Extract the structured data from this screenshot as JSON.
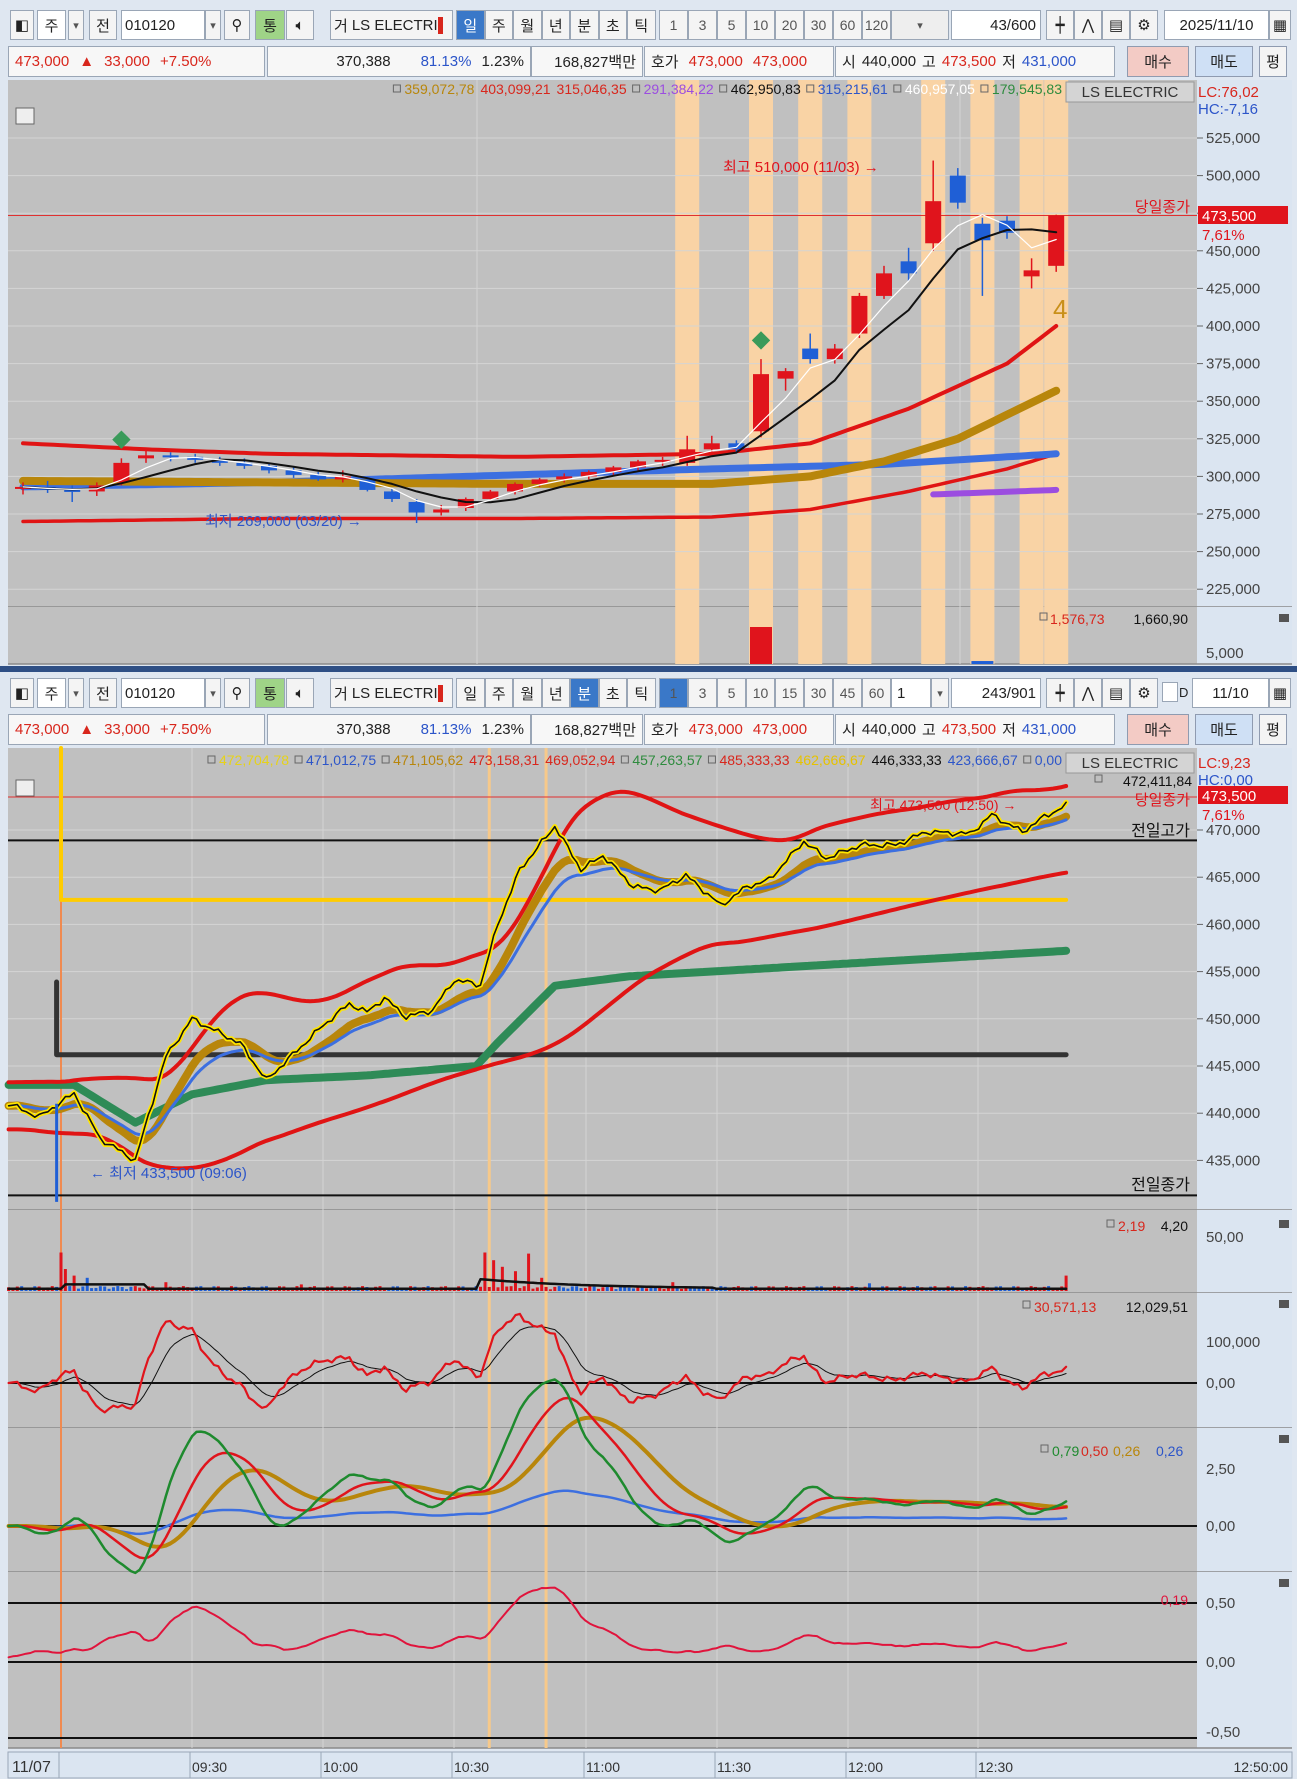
{
  "top_window": {
    "toolbar": {
      "market": "주",
      "prev": "전",
      "code": "010120",
      "tong": "통",
      "geo": "거",
      "name": "LS ELECTRI",
      "periods": [
        "일",
        "주",
        "월",
        "년",
        "분",
        "초",
        "틱"
      ],
      "active_period": "일",
      "intervals": [
        "1",
        "3",
        "5",
        "10",
        "20",
        "30",
        "60",
        "120"
      ],
      "count": "43",
      "total": "/600",
      "date": "2025/11/10"
    },
    "legend": [
      {
        "v": "359,072,78",
        "c": "#b8860b",
        "box": true
      },
      {
        "v": "403,099,21",
        "c": "#d8261c"
      },
      {
        "v": "315,046,35",
        "c": "#d8261c"
      },
      {
        "v": "291,384,22",
        "c": "#9b4de0",
        "box": true
      },
      {
        "v": "462,950,83",
        "c": "#111111",
        "box": true
      },
      {
        "v": "315,215,61",
        "c": "#2c55c9",
        "box": true
      },
      {
        "v": "460,957,05",
        "c": "#ffffff",
        "box": true
      },
      {
        "v": "179,545,83",
        "c": "#2e8b3e",
        "box": true
      }
    ],
    "title": "LS ELECTRIC",
    "lc": "LC:76,02",
    "hc": "HC:-7,16",
    "high_label": "최고 510,000 (11/03) →",
    "low_label": "최저 269,000 (03/20) →",
    "close_label": "당일종가",
    "signal": "4",
    "price_tag": "473,500",
    "pct_tag": "7,61%",
    "vol_legend": [
      "1,576,73",
      "1,660,90"
    ],
    "axis": [
      "525,000",
      "500,000",
      "475,000",
      "450,000",
      "425,000",
      "400,000",
      "375,000",
      "350,000",
      "325,000",
      "300,000",
      "275,000",
      "250,000",
      "225,000"
    ],
    "vol_axis": "5,000"
  },
  "bottom_window": {
    "toolbar": {
      "market": "주",
      "prev": "전",
      "code": "010120",
      "tong": "통",
      "geo": "거",
      "name": "LS ELECTRI",
      "periods": [
        "일",
        "주",
        "월",
        "년",
        "분",
        "초",
        "틱"
      ],
      "active_period": "분",
      "intervals": [
        "1",
        "3",
        "5",
        "10",
        "15",
        "30",
        "45",
        "60"
      ],
      "active_interval": "1",
      "unit": "1",
      "count": "243",
      "total": "/901",
      "check": "D",
      "date": "11/10"
    },
    "legend": [
      {
        "v": "472,704,78",
        "c": "#e6d21a",
        "box": true
      },
      {
        "v": "471,012,75",
        "c": "#2c55c9",
        "box": true
      },
      {
        "v": "471,105,62",
        "c": "#b8860b",
        "box": true
      },
      {
        "v": "473,158,31",
        "c": "#d8261c"
      },
      {
        "v": "469,052,94",
        "c": "#d8261c"
      },
      {
        "v": "457,263,57",
        "c": "#2e8b3e",
        "box": true
      },
      {
        "v": "485,333,33",
        "c": "#d8261c",
        "box": true
      },
      {
        "v": "462,666,67",
        "c": "#e6c200"
      },
      {
        "v": "446,333,33",
        "c": "#111111"
      },
      {
        "v": "423,666,67",
        "c": "#2c55c9"
      },
      {
        "v": "0,00",
        "c": "#2c55c9",
        "box": true
      }
    ],
    "legend2": "472,411,84",
    "title": "LS ELECTRIC",
    "lc": "LC:9,23",
    "hc": "HC:0,00",
    "high_label": "최고 473,500 (12:50) →",
    "low_label": "← 최저 433,500 (09:06)",
    "prev_high": "전일고가",
    "prev_close": "전일종가",
    "close_label": "당일종가",
    "price_tag": "473,500",
    "pct_tag": "7,61%",
    "axis": [
      "470,000",
      "465,000",
      "460,000",
      "455,000",
      "450,000",
      "445,000",
      "440,000",
      "435,000"
    ],
    "vol_legend": [
      "2,19",
      "4,20"
    ],
    "vol_axis": "50,00",
    "p3_legend": [
      "30,571,13",
      "12,029,51"
    ],
    "p3_axis": [
      "100,000",
      "0,00"
    ],
    "p4_legend": [
      "0,79",
      "0,50",
      "0,26",
      "0,26"
    ],
    "p4_axis": [
      "2,50",
      "0,00"
    ],
    "p5_legend": "0,19",
    "p5_axis": [
      "0,50",
      "0,00",
      "-0,50"
    ],
    "time_labels": [
      "11/07",
      "09:30",
      "10:00",
      "10:30",
      "11:00",
      "11:30",
      "12:00",
      "12:30"
    ],
    "time_end": "12:50:00"
  },
  "info": {
    "price": "473,000",
    "arrow": "▲",
    "change": "33,000",
    "pct": "+7.50%",
    "volume": "370,388",
    "ratio": "81.13%",
    "turnover": "1.23%",
    "amount": "168,827백만",
    "hoga_label": "호가",
    "ask": "473,000",
    "bid": "473,000",
    "open_label": "시",
    "open": "440,000",
    "high_label": "고",
    "high": "473,500",
    "low_label": "저",
    "low": "431,000",
    "buy": "매수",
    "sell": "매도",
    "eval": "평"
  },
  "chart_data": [
    {
      "type": "candlestick",
      "name": "daily",
      "unit": "KRW thousands",
      "ylim": [
        210,
        535
      ],
      "ohlc": [
        [
          292,
          296,
          288,
          293
        ],
        [
          293,
          297,
          289,
          291
        ],
        [
          291,
          294,
          283,
          290
        ],
        [
          290,
          296,
          287,
          294
        ],
        [
          296,
          312,
          294,
          309
        ],
        [
          312,
          318,
          309,
          314
        ],
        [
          314,
          316,
          310,
          313
        ],
        [
          313,
          315,
          309,
          311
        ],
        [
          311,
          313,
          307,
          309
        ],
        [
          309,
          312,
          305,
          307
        ],
        [
          307,
          309,
          302,
          304
        ],
        [
          304,
          306,
          299,
          301
        ],
        [
          301,
          303,
          297,
          298
        ],
        [
          298,
          304,
          296,
          300
        ],
        [
          298,
          299,
          290,
          291
        ],
        [
          290,
          292,
          283,
          285
        ],
        [
          283,
          285,
          269,
          276
        ],
        [
          276,
          281,
          274,
          278
        ],
        [
          279,
          286,
          277,
          285
        ],
        [
          285,
          291,
          284,
          290
        ],
        [
          290,
          296,
          288,
          295
        ],
        [
          295,
          299,
          293,
          298
        ],
        [
          298,
          302,
          296,
          300
        ],
        [
          300,
          304,
          298,
          303
        ],
        [
          303,
          307,
          301,
          306
        ],
        [
          306,
          311,
          304,
          310
        ],
        [
          310,
          313,
          307,
          311
        ],
        [
          309,
          327,
          307,
          318
        ],
        [
          318,
          327,
          315,
          322
        ],
        [
          322,
          324,
          316,
          318
        ],
        [
          330,
          378,
          326,
          368
        ],
        [
          365,
          372,
          357,
          370
        ],
        [
          385,
          395,
          375,
          378
        ],
        [
          378,
          388,
          375,
          385
        ],
        [
          395,
          422,
          392,
          420
        ],
        [
          420,
          440,
          418,
          435
        ],
        [
          443,
          452,
          430,
          435
        ],
        [
          455,
          510,
          450,
          483
        ],
        [
          500,
          505,
          478,
          482
        ],
        [
          468,
          472,
          420,
          457
        ],
        [
          470,
          473,
          458,
          462
        ],
        [
          433,
          445,
          425,
          437
        ],
        [
          440,
          474,
          436,
          473.5
        ]
      ],
      "highlight": [
        27,
        30,
        32,
        34,
        37,
        39,
        41,
        42
      ],
      "signals": [
        4,
        30
      ],
      "bands": {
        "upper": [
          [
            0,
            322
          ],
          [
            5,
            318
          ],
          [
            10,
            315
          ],
          [
            20,
            313
          ],
          [
            28,
            315
          ],
          [
            32,
            322
          ],
          [
            36,
            345
          ],
          [
            40,
            375
          ],
          [
            42,
            400
          ]
        ],
        "lower": [
          [
            0,
            270
          ],
          [
            10,
            272
          ],
          [
            20,
            272
          ],
          [
            28,
            273
          ],
          [
            32,
            278
          ],
          [
            36,
            290
          ],
          [
            40,
            305
          ],
          [
            42,
            315
          ]
        ],
        "gold": [
          [
            0,
            297
          ],
          [
            10,
            296
          ],
          [
            20,
            295
          ],
          [
            28,
            295
          ],
          [
            32,
            300
          ],
          [
            35,
            310
          ],
          [
            38,
            325
          ],
          [
            42,
            357
          ]
        ],
        "blue": [
          [
            0,
            293
          ],
          [
            10,
            296
          ],
          [
            20,
            301
          ],
          [
            28,
            305
          ],
          [
            35,
            308
          ],
          [
            42,
            315
          ]
        ],
        "purple": [
          [
            37,
            288
          ],
          [
            42,
            291
          ]
        ]
      },
      "volume": [
        [
          30,
          100
        ],
        [
          39,
          8
        ]
      ]
    },
    {
      "type": "line",
      "name": "intraday 1-min",
      "unit": "KRW thousands",
      "ylim": [
        430.5,
        475
      ],
      "x_unit": "minutes from 09:00",
      "points": [
        [
          -12,
          441.0
        ],
        [
          -5,
          439.6
        ],
        [
          3,
          442.1
        ],
        [
          9,
          437.3
        ],
        [
          17,
          435.0
        ],
        [
          24,
          446
        ],
        [
          30,
          450
        ],
        [
          41,
          447.4
        ],
        [
          47,
          443.5
        ],
        [
          60,
          449.3
        ],
        [
          66,
          451.6
        ],
        [
          70,
          450.7
        ],
        [
          74,
          452.2
        ],
        [
          79,
          450.2
        ],
        [
          85,
          450.9
        ],
        [
          90,
          454.1
        ],
        [
          96,
          453.6
        ],
        [
          100,
          460.1
        ],
        [
          105,
          465.8
        ],
        [
          113,
          470.4
        ],
        [
          119,
          465.8
        ],
        [
          124,
          467.3
        ],
        [
          131,
          464.0
        ],
        [
          137,
          463.6
        ],
        [
          143,
          465.2
        ],
        [
          151,
          462.0
        ],
        [
          157,
          464.0
        ],
        [
          162,
          464.7
        ],
        [
          170,
          468.8
        ],
        [
          175,
          467.0
        ],
        [
          183,
          468.4
        ],
        [
          191,
          468.4
        ],
        [
          198,
          469.8
        ],
        [
          208,
          469.6
        ],
        [
          213,
          471.6
        ],
        [
          220,
          469.8
        ],
        [
          225,
          471.4
        ],
        [
          230,
          472.6
        ]
      ],
      "green_ma": [
        [
          -12,
          443
        ],
        [
          3,
          443
        ],
        [
          17,
          439
        ],
        [
          30,
          442
        ],
        [
          47,
          443.5
        ],
        [
          70,
          444
        ],
        [
          95,
          445
        ],
        [
          100,
          447.5
        ],
        [
          113,
          453.5
        ],
        [
          130,
          454.5
        ],
        [
          230,
          457.2
        ]
      ],
      "levels": {
        "prev_high": 468.9,
        "prev_close": 431.3,
        "today_close": 473.5,
        "yellow": 462.6,
        "black": 446.2
      },
      "markers_min": [
        0,
        98,
        111
      ],
      "volume_spikes": [
        [
          0,
          35
        ],
        [
          1,
          20
        ],
        [
          3,
          14
        ],
        [
          6,
          12
        ],
        [
          24,
          8
        ],
        [
          55,
          6
        ],
        [
          97,
          35
        ],
        [
          99,
          28
        ],
        [
          101,
          22
        ],
        [
          104,
          18
        ],
        [
          107,
          34
        ],
        [
          110,
          12
        ],
        [
          140,
          8
        ],
        [
          185,
          7
        ],
        [
          230,
          14
        ]
      ]
    }
  ]
}
